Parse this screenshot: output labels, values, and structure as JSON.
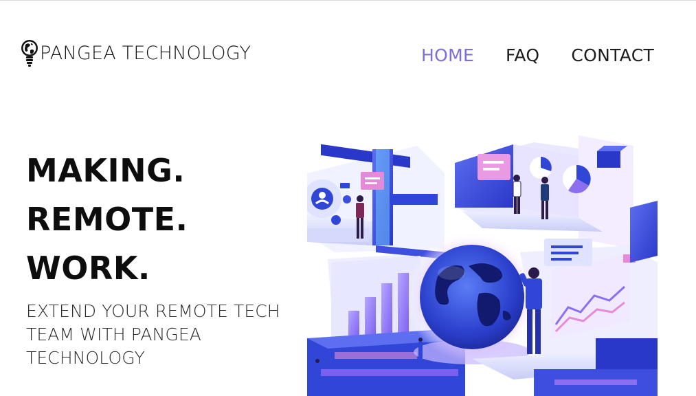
{
  "header": {
    "brand_name": "PANGEA TECHNOLOGY",
    "logo_icon": "lightbulb-globe-icon"
  },
  "nav": {
    "items": [
      {
        "label": "HOME",
        "active": true
      },
      {
        "label": "FAQ",
        "active": false
      },
      {
        "label": "CONTACT",
        "active": false
      }
    ],
    "active_color": "#7b6fe0"
  },
  "hero": {
    "title_lines": [
      "MAKING.",
      "REMOTE.",
      "WORK."
    ],
    "subtitle": "EXTEND YOUR REMOTE TECH TEAM WITH PANGEA TECHNOLOGY"
  },
  "colors": {
    "text": "#111111",
    "illustration_blue": "#2f46d6",
    "illustration_violet": "#8c6ff0",
    "illustration_pink": "#e58ad8"
  }
}
